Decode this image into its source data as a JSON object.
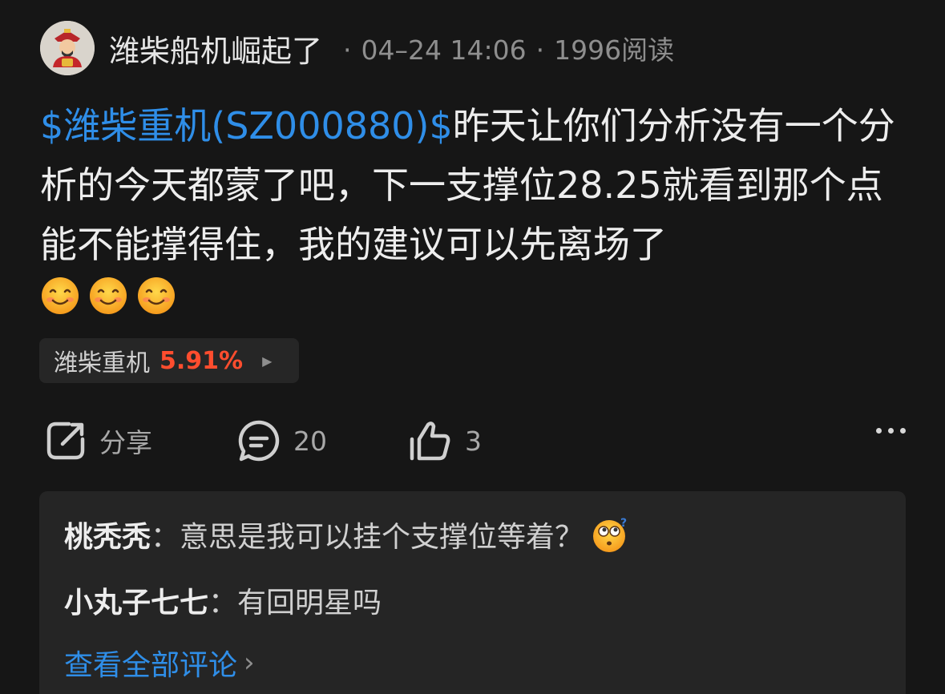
{
  "header": {
    "username": "潍柴船机崛起了",
    "separator": "·",
    "timestamp": "04–24 14:06",
    "reads": "1996阅读"
  },
  "post": {
    "stock_link": "$潍柴重机(SZ000880)$",
    "body": "昨天让你们分析没有一个分析的今天都蒙了吧，下一支撑位28.25就看到那个点能不能撑得住，我的建议可以先离场了",
    "emojis": [
      "smile-emoji",
      "smile-emoji",
      "smile-emoji"
    ]
  },
  "stock_pill": {
    "name": "潍柴重机",
    "change": "5.91%",
    "change_color": "#ff4d2e",
    "arrow": "▶"
  },
  "actions": {
    "share_label": "分享",
    "comment_count": "20",
    "like_count": "3"
  },
  "comments": [
    {
      "author": "桃秃秃",
      "sep": "：",
      "text": "意思是我可以挂个支撑位等着？",
      "emoji": "confused-emoji"
    },
    {
      "author": "小丸子七七",
      "sep": "：",
      "text": "有回明星吗"
    }
  ],
  "view_all": {
    "label": "查看全部评论",
    "chevron": "›"
  },
  "colors": {
    "background": "#161616",
    "link": "#2f8ee8",
    "up": "#ff4d2e"
  }
}
